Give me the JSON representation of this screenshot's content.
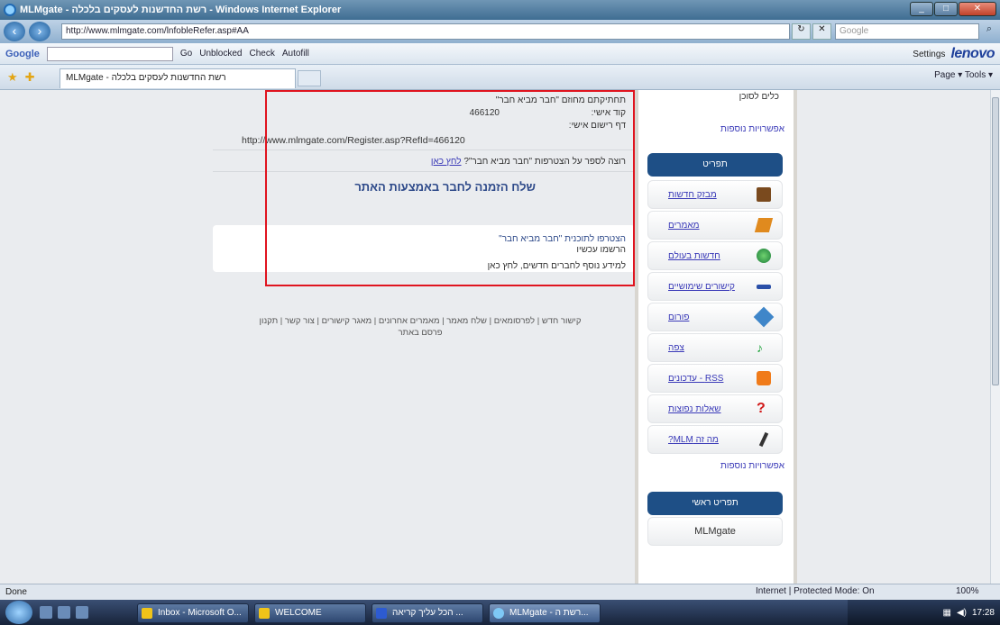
{
  "window": {
    "title": "MLMgate - רשת החדשנות לעסקים בלכלה - Windows Internet Explorer"
  },
  "address": {
    "url": "http://www.mlmgate.com/lnfobleRefer.asp#AA",
    "search_placeholder": "Google"
  },
  "google_toolbar": {
    "logo": "Google",
    "go": "Go",
    "blocked": "Unblocked",
    "check": "Check",
    "autofill": "Autofill",
    "settings": "Settings",
    "brand": "lenovo"
  },
  "tab": {
    "label": "MLMgate - רשת החדשנות לעסקים בלכלה",
    "commands": "Page ▾   Tools ▾"
  },
  "main": {
    "line1": "תחתיקתם מחוזם \"חבר מביא חבר\"",
    "number": "466120",
    "line2": "קוד אישי:",
    "line3": "דף רישום אישי:",
    "register_url": "http://www.mlmgate.com/Register.asp?RefId=466120",
    "share_text": "רוצה לספר על הצטרפות \"חבר מביא חבר\"?",
    "share_link": "לחץ כאן",
    "invite_title": "שלח הזמנה לחבר באמצעות האתר",
    "box_line1": "הצטרפו לתוכנית \"חבר מביא חבר\"",
    "box_line2": "הרשמו עכשיו",
    "box_line3": "למידע נוסף לחברים חדשים, לחץ כאן",
    "footer_links": "קישור חדש | לפרסומאים | שלח מאמר | מאמרים אחרונים | מאגר קישורים | צור קשר | תקנון",
    "footer_line2": "פרסם באתר"
  },
  "sidebar": {
    "top_item": "כלים לסוכן",
    "section1": "אפשרויות נוספות",
    "head1": "תפריט",
    "items": [
      {
        "label": "מבזק חדשות",
        "icon": "book-icon"
      },
      {
        "label": "מאמרים",
        "icon": "pen-icon"
      },
      {
        "label": "חדשות בעולם",
        "icon": "globe-icon"
      },
      {
        "label": "קישורים שימושיים",
        "icon": "link-icon"
      },
      {
        "label": "פורום",
        "icon": "gear-icon"
      },
      {
        "label": "צפה",
        "icon": "music-icon"
      },
      {
        "label": "RSS - עדכונים",
        "icon": "rss-icon"
      },
      {
        "label": "שאלות נפוצות",
        "icon": "question-icon"
      },
      {
        "label": "מה זה MLM?",
        "icon": "pencil-icon"
      }
    ],
    "section2": "אפשרויות נוספות",
    "head2": "תפריט ראשי",
    "brand_item": "MLMgate"
  },
  "status": {
    "left": "Done",
    "zone": "Internet | Protected Mode: On",
    "zoom": "100%"
  },
  "taskbar": {
    "tasks": [
      "Inbox - Microsoft O...",
      "WELCOME",
      "הכל עליך קריאה ...",
      "MLMgate - רשת ה..."
    ],
    "clock": "17:28"
  },
  "colors": {
    "sidebar_head": "#1e4f86",
    "highlight_border": "#e0141f",
    "link": "#3a3ab8"
  }
}
